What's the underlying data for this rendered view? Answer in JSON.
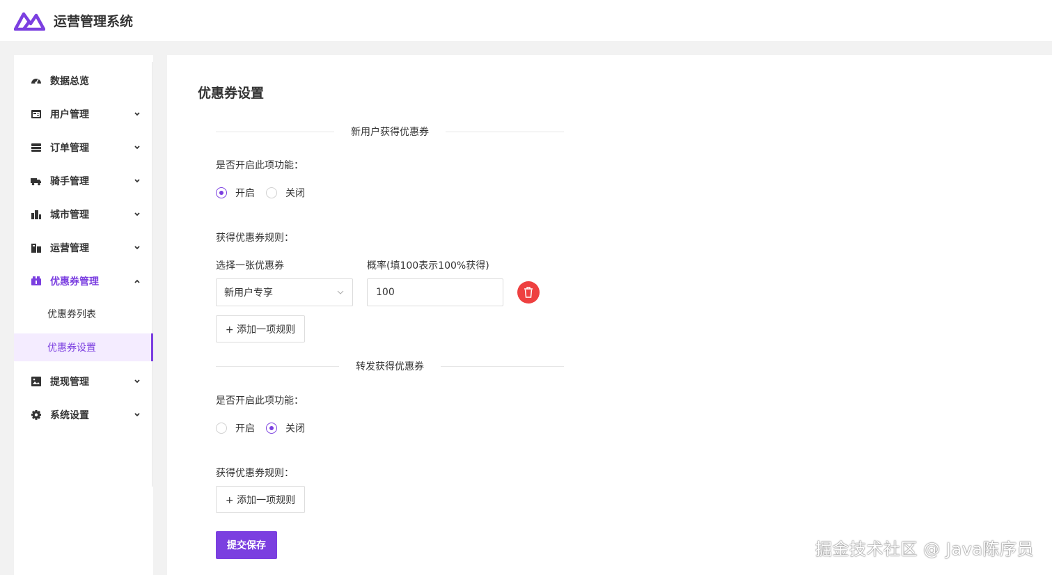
{
  "app": {
    "title": "运营管理系统",
    "accent": "#7b3fe0"
  },
  "sidebar": {
    "items": [
      {
        "label": "数据总览",
        "icon": "dashboard-icon"
      },
      {
        "label": "用户管理",
        "icon": "user-card-icon"
      },
      {
        "label": "订单管理",
        "icon": "order-stack-icon"
      },
      {
        "label": "骑手管理",
        "icon": "truck-icon"
      },
      {
        "label": "城市管理",
        "icon": "city-icon"
      },
      {
        "label": "运营管理",
        "icon": "operation-icon"
      },
      {
        "label": "优惠券管理",
        "icon": "coupon-icon"
      },
      {
        "label": "提现管理",
        "icon": "image-icon"
      },
      {
        "label": "系统设置",
        "icon": "gear-icon"
      }
    ],
    "sub_items": [
      {
        "label": "优惠券列表"
      },
      {
        "label": "优惠券设置"
      }
    ]
  },
  "main": {
    "title": "优惠券设置",
    "section_new_user": {
      "divider": "新用户获得优惠券",
      "enable_label": "是否开启此项功能：",
      "radio_on": "开启",
      "radio_off": "关闭",
      "selected": "开启",
      "rules_label": "获得优惠券规则：",
      "select_label": "选择一张优惠券",
      "prob_label": "概率(填100表示100%获得)",
      "select_value": "新用户专享",
      "prob_value": "100",
      "add_rule": "+ 添加一项规则"
    },
    "section_share": {
      "divider": "转发获得优惠券",
      "enable_label": "是否开启此项功能：",
      "radio_on": "开启",
      "radio_off": "关闭",
      "selected": "关闭",
      "rules_label": "获得优惠券规则：",
      "add_rule": "+ 添加一项规则"
    },
    "submit": "提交保存"
  },
  "watermark": "掘金技术社区 @ Java陈序员"
}
